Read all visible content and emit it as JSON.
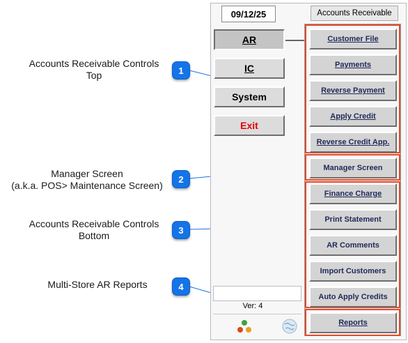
{
  "callouts": [
    {
      "num": "1",
      "line1": "Accounts Receivable Controls",
      "line2": "Top"
    },
    {
      "num": "2",
      "line1": "Manager Screen",
      "line2": "(a.k.a. POS> Maintenance Screen)"
    },
    {
      "num": "3",
      "line1": "Accounts Receivable Controls",
      "line2": "Bottom"
    },
    {
      "num": "4",
      "line1": "Multi-Store AR Reports",
      "line2": ""
    }
  ],
  "header": {
    "date": "09/12/25",
    "title": "Accounts Receivable"
  },
  "left_nav": {
    "ar": "AR",
    "ic": "IC",
    "system": "System",
    "exit": "Exit"
  },
  "right_buttons": {
    "customer_file": "Customer File",
    "payments": "Payments",
    "reverse_payment": "Reverse Payment",
    "apply_credit": "Apply Credit",
    "reverse_credit": "Reverse Credit App.",
    "manager_screen": "Manager Screen",
    "finance_charge": "Finance Charge",
    "print_statement": "Print Statement",
    "ar_comments": "AR Comments",
    "import_customers": "Import Customers",
    "auto_apply_credits": "Auto Apply Credits",
    "reports": "Reports"
  },
  "footer": {
    "version": "Ver: 4"
  },
  "colors": {
    "badge": "#1474e8",
    "frame_highlight": "#e34a2a",
    "exit_text": "#e00000",
    "callout_line": "#1a73e8"
  }
}
